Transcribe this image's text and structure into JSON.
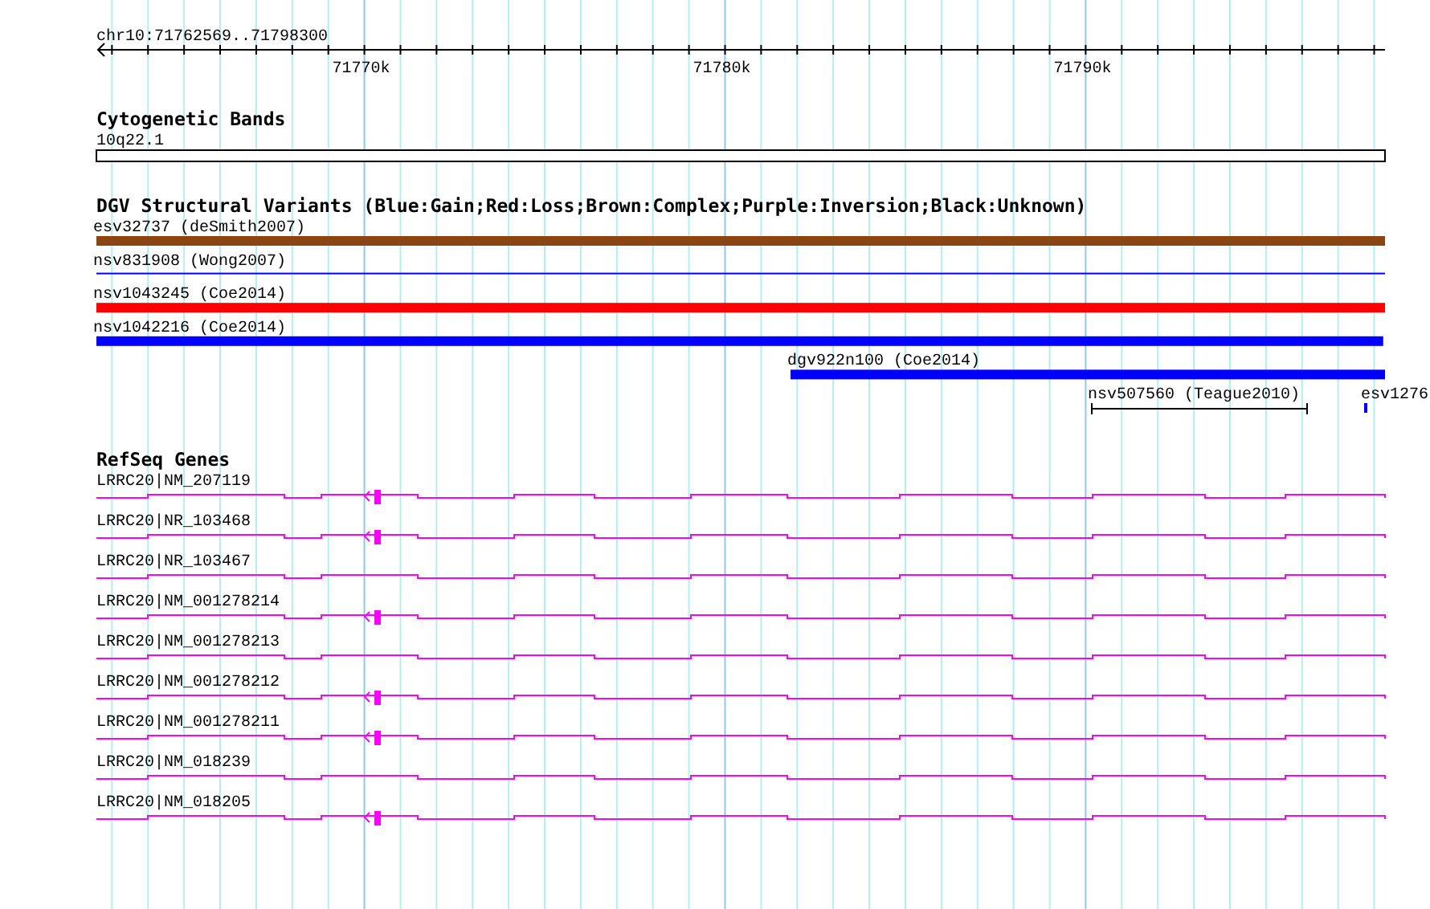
{
  "ruler": {
    "location": "chr10:71762569..71798300",
    "ticks": [
      {
        "label": "71770k"
      },
      {
        "label": "71780k"
      },
      {
        "label": "71790k"
      }
    ]
  },
  "cytoband": {
    "title": "Cytogenetic Bands",
    "band": "10q22.1"
  },
  "variants": {
    "title": "DGV Structural Variants (Blue:Gain;Red:Loss;Brown:Complex;Purple:Inversion;Black:Unknown)",
    "lanes": [
      {
        "features": [
          {
            "label": "esv32737 (deSmith2007)",
            "kind": "bar",
            "color": "#8b4513"
          }
        ]
      },
      {
        "features": [
          {
            "label": "nsv831908 (Wong2007)",
            "kind": "line",
            "color": "#0000ff"
          }
        ]
      },
      {
        "features": [
          {
            "label": "nsv1043245 (Coe2014)",
            "kind": "bar",
            "color": "#ff0000"
          }
        ]
      },
      {
        "features": [
          {
            "label": "nsv1042216 (Coe2014)",
            "kind": "bar",
            "color": "#0000ff"
          }
        ]
      },
      {
        "features": [
          {
            "label": "dgv922n100 (Coe2014)",
            "kind": "bar",
            "color": "#0000ff"
          }
        ]
      },
      {
        "features": [
          {
            "label": "nsv507560 (Teague2010)",
            "kind": "interval",
            "color": "#000000"
          },
          {
            "label": "esv1276",
            "kind": "bar",
            "color": "#0000ff"
          }
        ]
      }
    ]
  },
  "genes": {
    "title": "RefSeq Genes",
    "transcripts": [
      {
        "label": "LRRC20|NM_207119",
        "exon": true
      },
      {
        "label": "LRRC20|NR_103468",
        "exon": true
      },
      {
        "label": "LRRC20|NR_103467",
        "exon": false
      },
      {
        "label": "LRRC20|NM_001278214",
        "exon": true
      },
      {
        "label": "LRRC20|NM_001278213",
        "exon": false
      },
      {
        "label": "LRRC20|NM_001278212",
        "exon": true
      },
      {
        "label": "LRRC20|NM_001278211",
        "exon": true
      },
      {
        "label": "LRRC20|NM_018239",
        "exon": false
      },
      {
        "label": "LRRC20|NM_018205",
        "exon": true
      }
    ]
  }
}
